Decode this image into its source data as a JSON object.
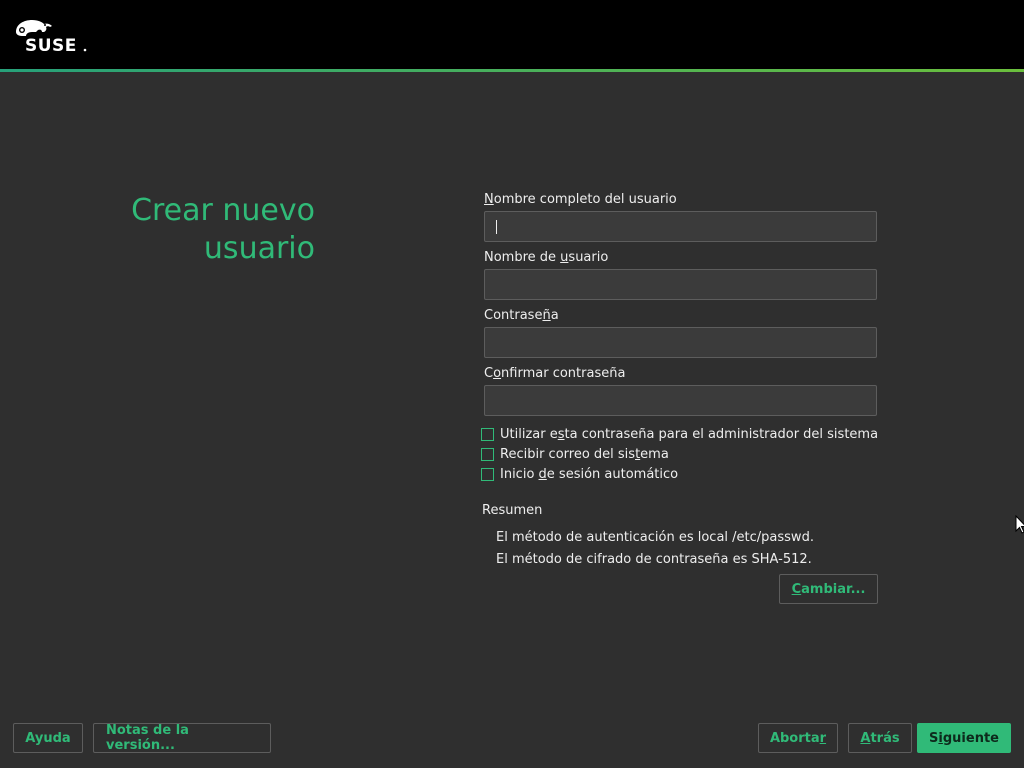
{
  "header": {
    "logo_text": "SUSE",
    "brand_color": "#30ba78",
    "accent_line_colors": [
      "#27a17a",
      "#6bbf3d"
    ]
  },
  "page": {
    "title_line1": "Crear nuevo",
    "title_line2": "usuario"
  },
  "form": {
    "fullname": {
      "label_key": "N",
      "label_rest": "ombre completo del usuario",
      "value": ""
    },
    "username": {
      "label_pre": "Nombre de ",
      "label_key": "u",
      "label_rest": "suario",
      "value": ""
    },
    "password": {
      "label_pre": "Contrase",
      "label_key": "ñ",
      "label_rest": "a",
      "value": ""
    },
    "confirm": {
      "label_pre": "C",
      "label_key": "o",
      "label_rest": "nfirmar contraseña",
      "value": ""
    }
  },
  "options": {
    "admin_password": {
      "pre": "Utilizar e",
      "key": "s",
      "rest": "ta contraseña para el administrador del sistema",
      "checked": false
    },
    "system_mail": {
      "pre": "Recibir correo del sis",
      "key": "t",
      "rest": "ema",
      "checked": false
    },
    "autologin": {
      "pre": "Inicio ",
      "key": "d",
      "rest": "e sesión automático",
      "checked": false
    }
  },
  "summary": {
    "title": "Resumen",
    "line1": "El método de autenticación es local /etc/passwd.",
    "line2": "El método de cifrado de contraseña es SHA-512.",
    "change_key": "C",
    "change_rest": "ambiar..."
  },
  "footer": {
    "help_label": "Ayuda",
    "release_notes_label": "Notas de la versión...",
    "abort_pre": "Aborta",
    "abort_key": "r",
    "back_key": "A",
    "back_rest": "trás",
    "next_pre": "S",
    "next_key": "i",
    "next_rest": "guiente"
  }
}
